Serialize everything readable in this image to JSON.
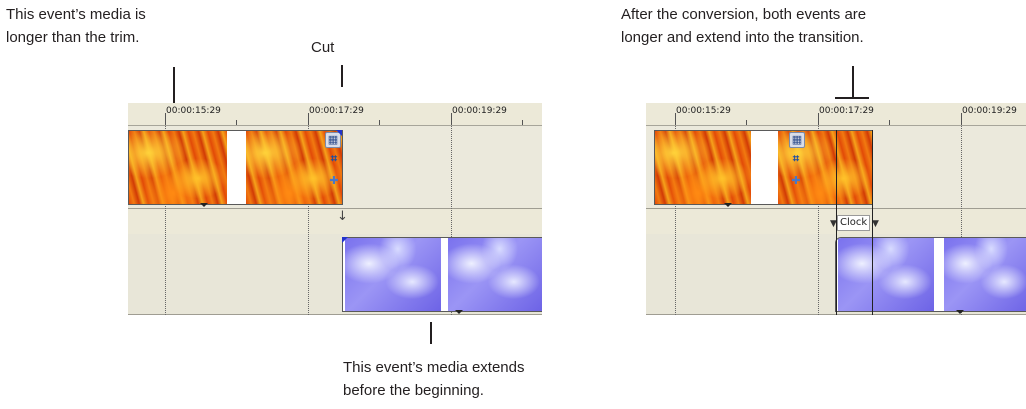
{
  "callouts": {
    "longer_trim": [
      "This event’s media is",
      "longer than the trim."
    ],
    "cut": "Cut",
    "after_conversion": [
      "After the conversion, both events are",
      "longer and extend into the transition."
    ],
    "extends_before": [
      "This event’s media extends",
      "before the beginning."
    ]
  },
  "left_panel": {
    "ruler_ticks": [
      "00:00:15:29",
      "00:00:17:29",
      "00:00:19:29"
    ],
    "event_icons": [
      "film-icon",
      "crop-icon",
      "pan-icon"
    ]
  },
  "right_panel": {
    "ruler_ticks": [
      "00:00:15:29",
      "00:00:17:29",
      "00:00:19:29"
    ],
    "event_icons": [
      "film-icon",
      "crop-icon",
      "pan-icon"
    ],
    "transition_label": "Clock"
  },
  "colors": {
    "timeline_bg": "#ece9d8",
    "fire_media": "#e8560a",
    "sky_media": "#8a84f2",
    "callout_text": "#231f20"
  }
}
